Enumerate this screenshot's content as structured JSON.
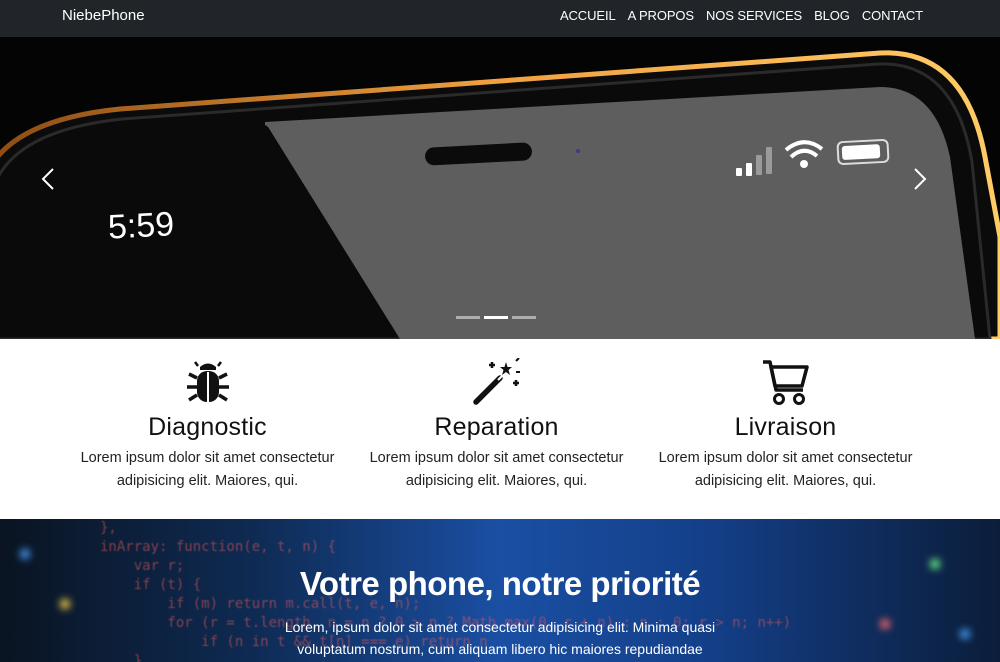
{
  "navbar": {
    "brand": "NiebePhone",
    "links": [
      "ACCUEIL",
      "A PROPOS",
      "NOS SERVICES",
      "BLOG",
      "CONTACT"
    ]
  },
  "hero": {
    "clock": "5:59",
    "prev_icon": "chevron-left-icon",
    "next_icon": "chevron-right-icon",
    "slides_count": 3,
    "active_slide": 2
  },
  "features": [
    {
      "icon": "bug-icon",
      "title": "Diagnostic",
      "line1": "Lorem ipsum dolor sit amet consectetur",
      "line2": "adipisicing elit. Maiores, qui."
    },
    {
      "icon": "magic-wand-icon",
      "title": "Reparation",
      "line1": "Lorem ipsum dolor sit amet consectetur",
      "line2": "adipisicing elit. Maiores, qui."
    },
    {
      "icon": "shopping-cart-icon",
      "title": "Livraison",
      "line1": "Lorem ipsum dolor sit amet consectetur",
      "line2": "adipisicing elit. Maiores, qui."
    }
  ],
  "banner": {
    "title": "Votre phone, notre priorité",
    "line1": "Lorem, ipsum dolor sit amet consectetur adipisicing elit. Minima quasi",
    "line2": "voluptatum nostrum, cum aliquam libero hic maiores repudiandae"
  },
  "colors": {
    "navbar_bg": "#212529",
    "phone_edge": "#e8952a",
    "banner_blue": "#1a4fa3"
  }
}
